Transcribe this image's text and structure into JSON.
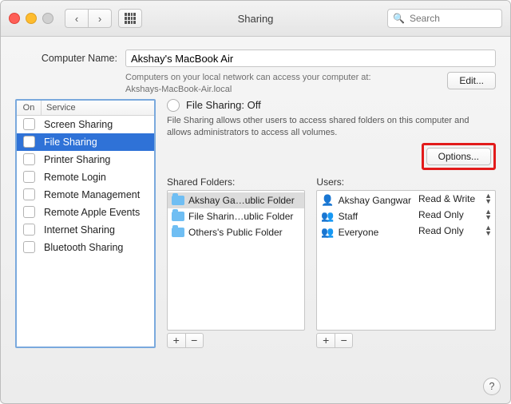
{
  "window": {
    "title": "Sharing",
    "search_placeholder": "Search"
  },
  "computer_name": {
    "label": "Computer Name:",
    "value": "Akshay's MacBook Air",
    "sub1": "Computers on your local network can access your computer at:",
    "sub2": "Akshays-MacBook-Air.local",
    "edit_btn": "Edit..."
  },
  "services": {
    "col_on": "On",
    "col_service": "Service",
    "items": [
      {
        "label": "Screen Sharing",
        "on": false
      },
      {
        "label": "File Sharing",
        "on": false,
        "selected": true
      },
      {
        "label": "Printer Sharing",
        "on": false
      },
      {
        "label": "Remote Login",
        "on": false
      },
      {
        "label": "Remote Management",
        "on": false
      },
      {
        "label": "Remote Apple Events",
        "on": false
      },
      {
        "label": "Internet Sharing",
        "on": false
      },
      {
        "label": "Bluetooth Sharing",
        "on": false
      }
    ]
  },
  "status": {
    "title": "File Sharing: Off",
    "desc": "File Sharing allows other users to access shared folders on this computer and allows administrators to access all volumes.",
    "options_btn": "Options..."
  },
  "shared": {
    "header": "Shared Folders:",
    "items": [
      {
        "label": "Akshay Ga…ublic Folder",
        "selected": true
      },
      {
        "label": "File Sharin…ublic Folder"
      },
      {
        "label": "Others's Public Folder"
      }
    ]
  },
  "users": {
    "header": "Users:",
    "items": [
      {
        "icon": "person",
        "label": "Akshay Gangwar",
        "perm": "Read & Write"
      },
      {
        "icon": "group",
        "label": "Staff",
        "perm": "Read Only"
      },
      {
        "icon": "group",
        "label": "Everyone",
        "perm": "Read Only"
      }
    ]
  }
}
